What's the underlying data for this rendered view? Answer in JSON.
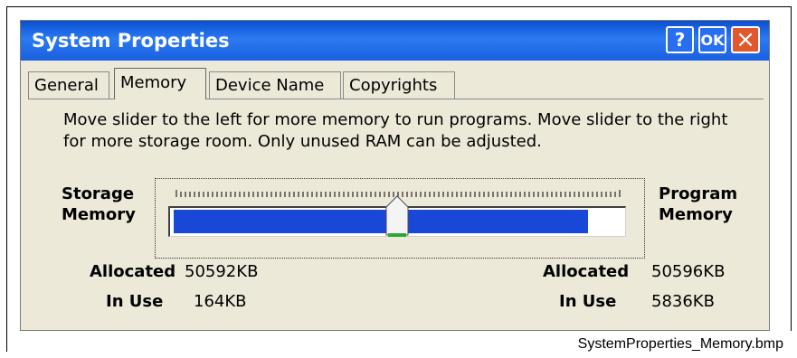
{
  "window": {
    "title": "System Properties",
    "help_label": "?",
    "ok_label": "OK",
    "close_label": "×"
  },
  "tabs": [
    {
      "label": "General",
      "active": false
    },
    {
      "label": "Memory",
      "active": true
    },
    {
      "label": "Device Name",
      "active": false
    },
    {
      "label": "Copyrights",
      "active": false
    }
  ],
  "memory": {
    "description": "Move slider to the left for more memory to run programs. Move slider to the right for more storage room. Only unused RAM can be adjusted.",
    "storage_label_line1": "Storage",
    "storage_label_line2": "Memory",
    "program_label_line1": "Program",
    "program_label_line2": "Memory",
    "slider_position": 0.5,
    "storage": {
      "allocated_label": "Allocated",
      "allocated": "50592KB",
      "in_use_label": "In Use",
      "in_use": "164KB"
    },
    "program": {
      "allocated_label": "Allocated",
      "allocated": "50596KB",
      "in_use_label": "In Use",
      "in_use": "5836KB"
    }
  },
  "caption": "SystemProperties_Memory.bmp",
  "colors": {
    "titlebar": "#2b7af0",
    "slider_fill": "#1947d8",
    "close_button": "#e2582d",
    "thumb_base": "#2fa53a"
  }
}
